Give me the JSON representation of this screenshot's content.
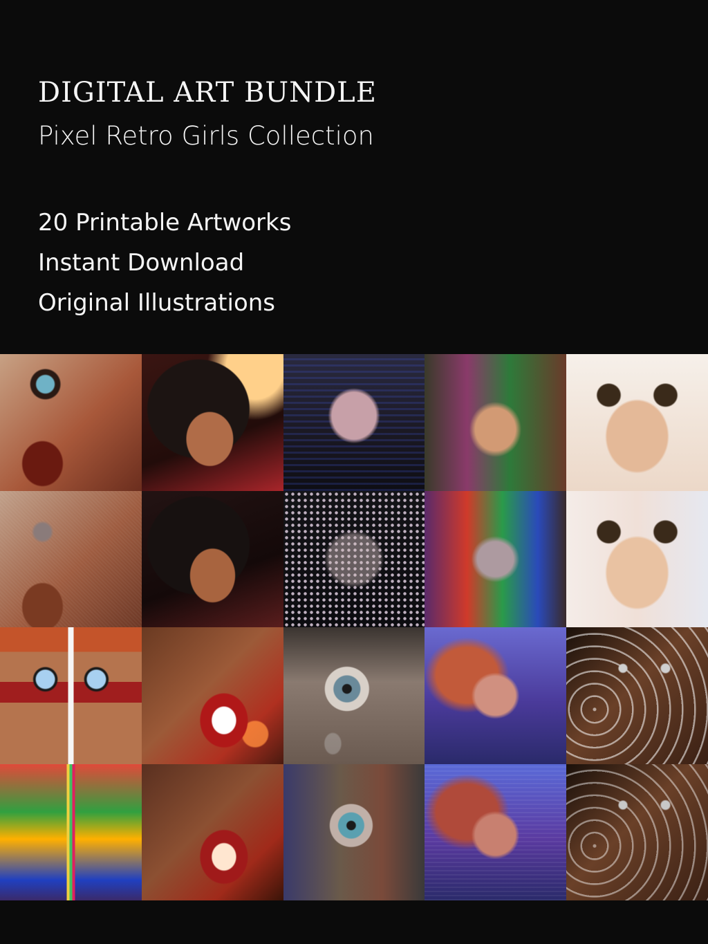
{
  "header": {
    "title": "DIGITAL ART BUNDLE",
    "subtitle": "Pixel Retro Girls Collection",
    "features": [
      "20 Printable Artworks",
      "Instant Download",
      "Original Illustrations"
    ]
  },
  "colors": {
    "background": "#0b0b0b",
    "text": "#f5f5f5"
  },
  "artwork_grid": {
    "columns": 5,
    "rows": 4
  }
}
